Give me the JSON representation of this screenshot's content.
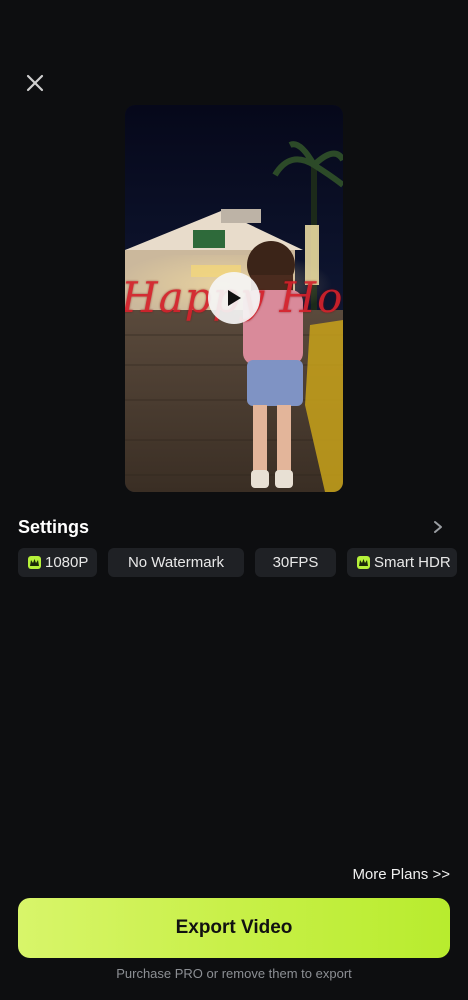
{
  "header": {
    "close_icon": "close-icon"
  },
  "preview": {
    "overlay_text": "Happy Holi",
    "play_icon": "play-icon"
  },
  "settings": {
    "title": "Settings",
    "chevron_icon": "chevron-right-icon",
    "chips": [
      {
        "label": "1080P",
        "pro": true
      },
      {
        "label": "No Watermark",
        "pro": false
      },
      {
        "label": "30FPS",
        "pro": false
      },
      {
        "label": "Smart HDR",
        "pro": true
      }
    ]
  },
  "footer": {
    "more_plans": "More Plans >>",
    "export_label": "Export Video",
    "note": "Purchase PRO or remove them to export"
  },
  "colors": {
    "background": "#0d0e10",
    "accent": "#c8f048",
    "chip_bg": "#1f2125",
    "overlay_red": "#d4212b"
  }
}
